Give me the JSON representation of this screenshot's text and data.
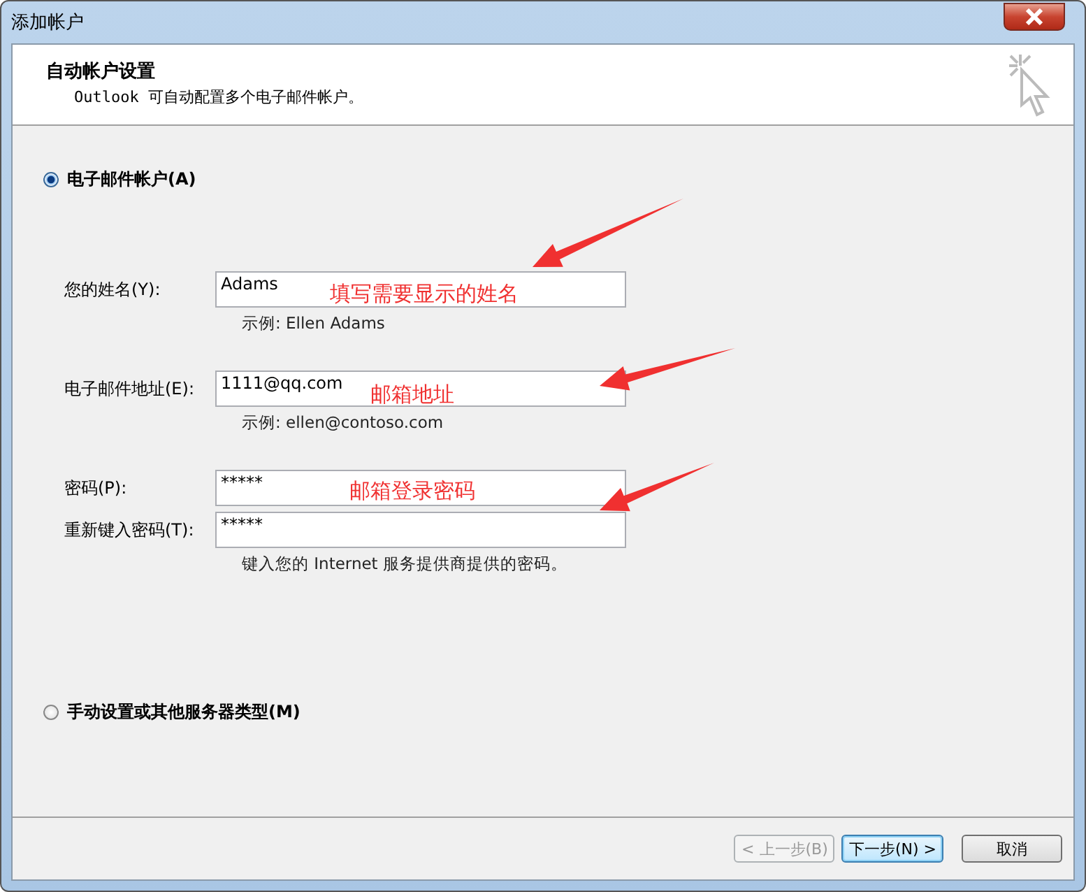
{
  "window": {
    "title": "添加帐户"
  },
  "header": {
    "title": "自动帐户设置",
    "subtitle": "Outlook 可自动配置多个电子邮件帐户。"
  },
  "options": [
    {
      "label": "电子邮件帐户(A)",
      "selected": true
    },
    {
      "label": "手动设置或其他服务器类型(M)",
      "selected": false
    }
  ],
  "fields": [
    {
      "label": "您的姓名(Y):",
      "value": "Adams",
      "hint": "示例: Ellen Adams"
    },
    {
      "label": "电子邮件地址(E):",
      "value": "1111@qq.com",
      "hint": "示例: ellen@contoso.com"
    },
    {
      "label": "密码(P):",
      "value": "*****"
    },
    {
      "label": "重新键入密码(T):",
      "value": "*****",
      "hint": "键入您的 Internet 服务提供商提供的密码。"
    }
  ],
  "annotations": [
    {
      "text": "填写需要显示的姓名"
    },
    {
      "text": "邮箱地址"
    },
    {
      "text": "邮箱登录密码"
    }
  ],
  "buttons": [
    {
      "label": "< 上一步(B)",
      "disabled": true,
      "default": false
    },
    {
      "label": "下一步(N) >",
      "disabled": false,
      "default": true
    },
    {
      "label": "取消",
      "disabled": false,
      "default": false
    }
  ]
}
